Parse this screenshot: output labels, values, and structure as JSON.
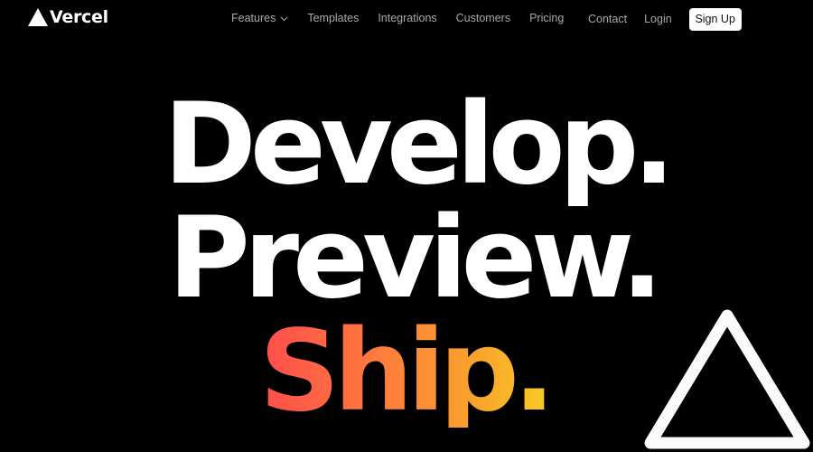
{
  "brand": {
    "name": "Vercel",
    "logo_icon": "triangle-logo-icon"
  },
  "nav": {
    "items": [
      {
        "label": "Features",
        "has_dropdown": true,
        "icon": "chevron-down-icon"
      },
      {
        "label": "Templates"
      },
      {
        "label": "Integrations"
      },
      {
        "label": "Customers"
      },
      {
        "label": "Pricing"
      }
    ]
  },
  "right_nav": {
    "contact_label": "Contact",
    "login_label": "Login",
    "signup_label": "Sign Up"
  },
  "hero": {
    "line_1": "Develop.",
    "line_2": "Preview.",
    "line_3": "Ship.",
    "gradient_colors": [
      "#ff4d4d",
      "#f9cb28"
    ]
  },
  "decoration": {
    "icon": "outline-triangle-icon"
  },
  "colors": {
    "background": "#000000",
    "text": "#ffffff",
    "nav_text": "#a8a8a8",
    "button_bg": "#ffffff"
  }
}
